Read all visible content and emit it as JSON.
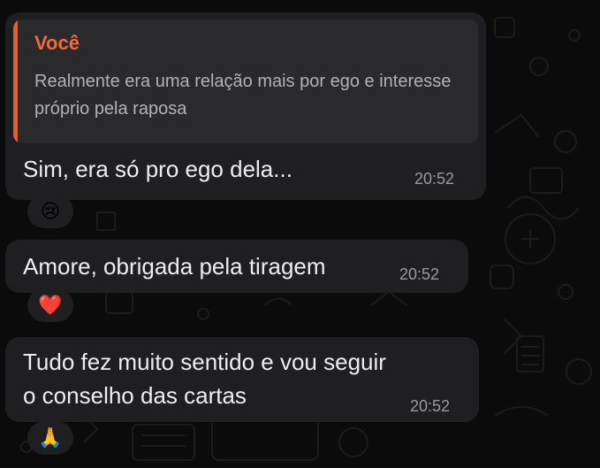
{
  "chat": {
    "quoted": {
      "author": "Você",
      "text": "Realmente era uma relação mais por ego e interesse próprio pela raposa"
    },
    "messages": [
      {
        "text": "Sim, era só pro ego dela...",
        "time": "20:52",
        "reaction": "😢"
      },
      {
        "text": "Amore, obrigada pela tiragem",
        "time": "20:52",
        "reaction": "❤️"
      },
      {
        "line1": "Tudo fez muito sentido e vou seguir",
        "line2": "o conselho das cartas",
        "time": "20:52",
        "reaction": "🙏"
      }
    ]
  },
  "colors": {
    "bubble": "#1f1f21",
    "quote_accent": "#f05a26",
    "background": "#0b0b0c"
  }
}
